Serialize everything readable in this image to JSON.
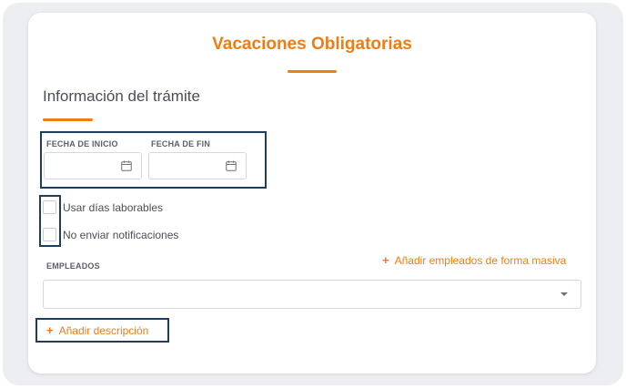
{
  "form": {
    "title": "Vacaciones Obligatorias",
    "section_title": "Información del trámite",
    "start_date_label": "FECHA DE INICIO",
    "end_date_label": "FECHA DE FIN",
    "start_date_value": "",
    "end_date_value": "",
    "checkboxes": [
      {
        "label": "Usar días laborables",
        "checked": false
      },
      {
        "label": "No enviar notificaciones",
        "checked": false
      }
    ],
    "employees_label": "EMPLEADOS",
    "bulk_add_label": "Añadir empleados de forma masiva",
    "employees_value": "",
    "add_description_label": "Añadir descripción",
    "plus_glyph": "+"
  },
  "icons": {
    "date_icon": "calendar-icon",
    "select_icon": "chevron-down-icon",
    "add_icon": "plus-icon"
  },
  "colors": {
    "accent": "#f07d14",
    "highlight_frame": "#1f3d5c",
    "text": "#4a4f55",
    "border": "#d5d9de"
  }
}
